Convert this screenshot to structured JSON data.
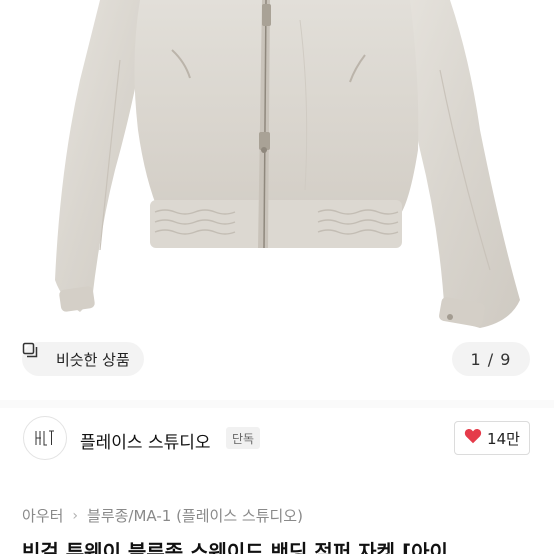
{
  "hero": {
    "similar_label": "비슷한 상품",
    "counter": "1 / 9"
  },
  "store": {
    "name": "플레이스 스튜디오",
    "badge": "단독",
    "likes": "14만"
  },
  "breadcrumb": {
    "items": [
      "아우터",
      "블루종/MA-1 (플레이스 스튜디오)"
    ]
  },
  "product": {
    "title": "빈걸 투웨이 블루종 스웨이드 밴딩 점퍼 자켓 [아이"
  },
  "colors": {
    "heart": "#e53b4a",
    "jacket": "#ddd9d2"
  }
}
